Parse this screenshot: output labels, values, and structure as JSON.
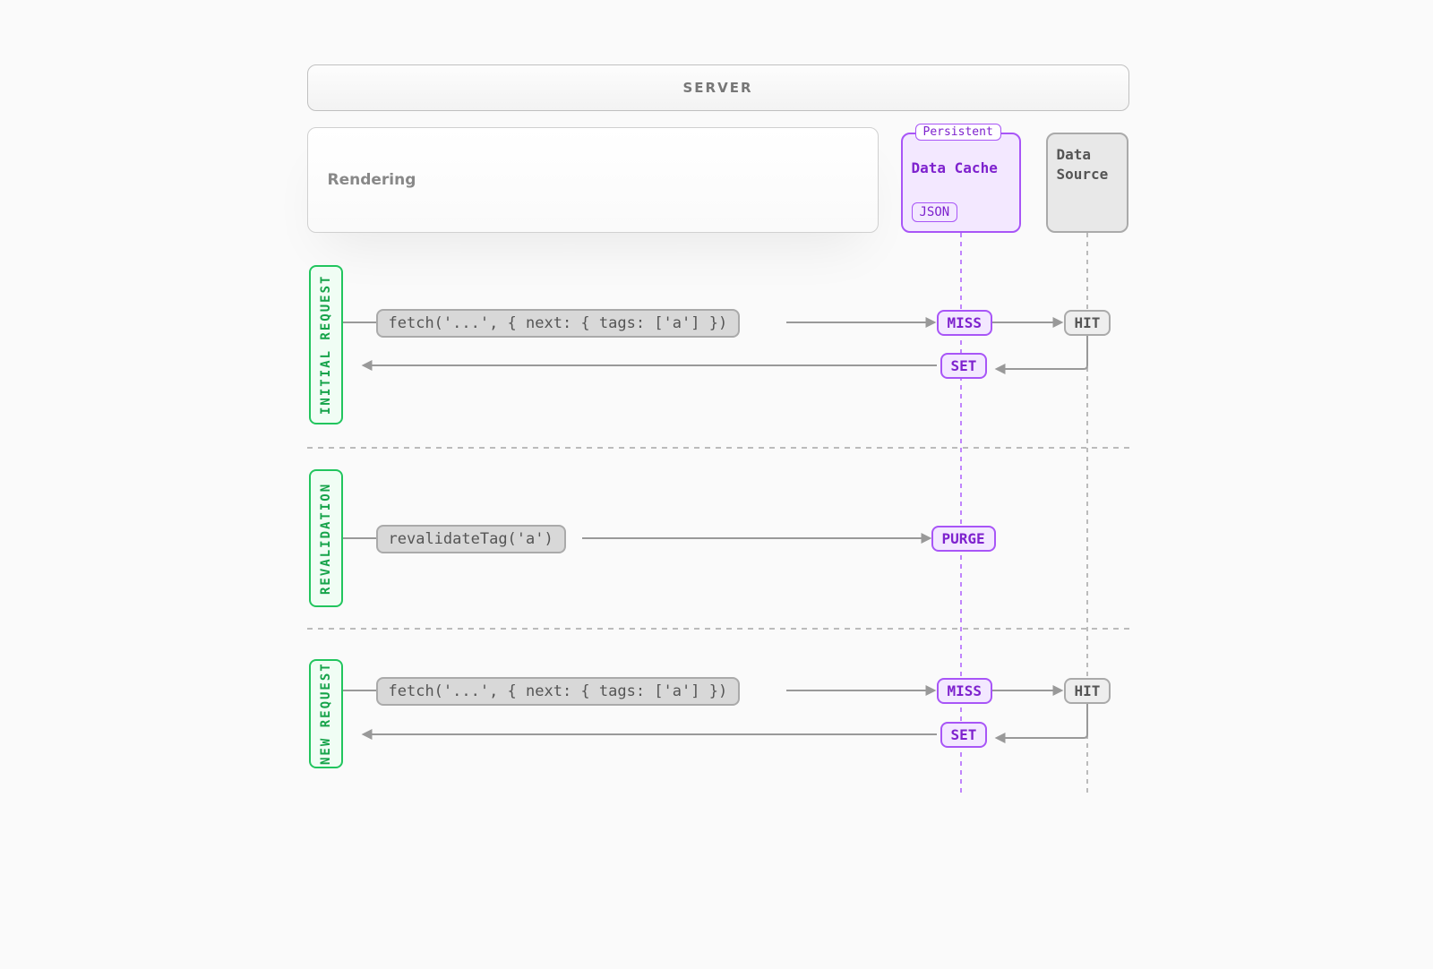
{
  "header": {
    "server_label": "SERVER"
  },
  "columns": {
    "rendering_label": "Rendering",
    "data_cache": {
      "persistent_badge": "Persistent",
      "title": "Data Cache",
      "json_badge": "JSON"
    },
    "data_source_label": "Data\nSource"
  },
  "phases": {
    "initial": {
      "label": "INITIAL REQUEST",
      "code": "fetch('...', { next: { tags: ['a'] })",
      "miss": "MISS",
      "hit": "HIT",
      "set": "SET"
    },
    "revalidation": {
      "label": "REVALIDATION",
      "code": "revalidateTag('a')",
      "purge": "PURGE"
    },
    "new_request": {
      "label": "NEW REQUEST",
      "code": "fetch('...', { next: { tags: ['a'] })",
      "miss": "MISS",
      "hit": "HIT",
      "set": "SET"
    }
  }
}
